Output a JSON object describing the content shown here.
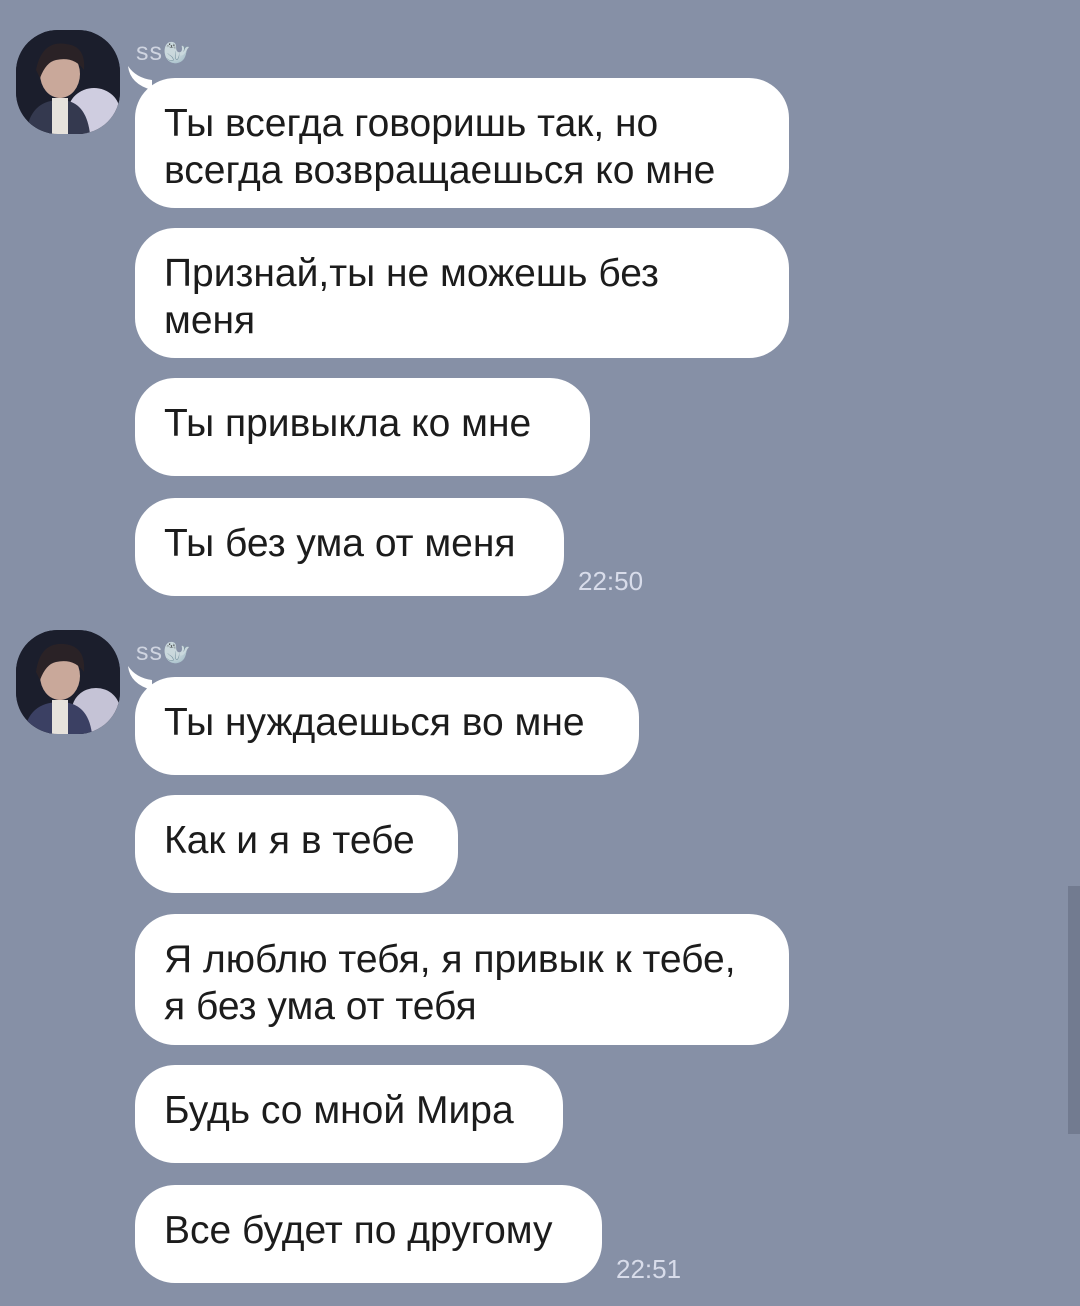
{
  "groups": [
    {
      "sender": "ss",
      "sender_emoji": "🦭",
      "time": "22:50",
      "messages": [
        "Ты всегда говоришь так, но всегда возвращаешься ко мне",
        "Признай,ты не можешь без меня",
        "Ты привыкла ко мне",
        "Ты без ума от меня"
      ]
    },
    {
      "sender": "ss",
      "sender_emoji": "🦭",
      "time": "22:51",
      "messages": [
        "Ты нуждаешься во мне",
        "Как и я в тебе",
        "Я люблю тебя, я привык к тебе, я без ума от тебя",
        "Будь со мной Мира",
        "Все будет по другому"
      ]
    }
  ],
  "colors": {
    "background": "#8690a6",
    "bubble": "#ffffff",
    "text": "#1c1c1c",
    "timestamp": "#d8dcea"
  }
}
